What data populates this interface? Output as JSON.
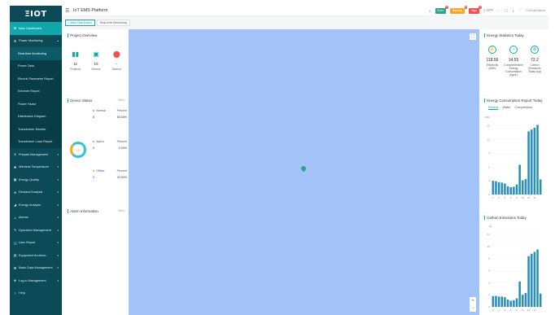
{
  "brand": "ΞIOT",
  "app_title": "IoT EMS Platform",
  "sidebar": {
    "items": [
      {
        "label": "Main Dashboard",
        "icon": "dashboard-icon",
        "glyph": "⊞",
        "state": "active"
      },
      {
        "label": "Power Monitoring",
        "icon": "power-icon",
        "glyph": "⚙",
        "state": "open",
        "arrow": "▴"
      },
      {
        "label": "Real-time Monitoring",
        "sub": true,
        "state": "active"
      },
      {
        "label": "Power Data",
        "sub": true
      },
      {
        "label": "Electric Parameter Report",
        "sub": true
      },
      {
        "label": "Extreme Report",
        "sub": true
      },
      {
        "label": "Power Factor",
        "sub": true
      },
      {
        "label": "Distribution Diagram",
        "sub": true
      },
      {
        "label": "Transformer Monitor",
        "sub": true
      },
      {
        "label": "Transformer Load Report",
        "sub": true
      },
      {
        "label": "Prepaid Management",
        "icon": "wallet-icon",
        "glyph": "$",
        "arrow": "▾"
      },
      {
        "label": "Wireless Temperature",
        "icon": "thermometer-icon",
        "glyph": "✱",
        "arrow": "▾"
      },
      {
        "label": "Energy Quality",
        "icon": "quality-icon",
        "glyph": "▦",
        "arrow": "▾"
      },
      {
        "label": "Demand Analysis",
        "icon": "demand-icon",
        "glyph": "⊕",
        "arrow": "▾"
      },
      {
        "label": "Energy Analysis",
        "icon": "analysis-icon",
        "glyph": "◢",
        "arrow": "▾"
      },
      {
        "label": "Alarms",
        "icon": "bell-icon",
        "glyph": "♫",
        "arrow": "▾"
      },
      {
        "label": "Operation Management",
        "icon": "wrench-icon",
        "glyph": "✎",
        "arrow": "▾"
      },
      {
        "label": "User Report",
        "icon": "report-icon",
        "glyph": "❑",
        "arrow": "▾"
      },
      {
        "label": "Equipment Archives",
        "icon": "archive-icon",
        "glyph": "▤",
        "arrow": "▾"
      },
      {
        "label": "Basic Data Management",
        "icon": "database-icon",
        "glyph": "⌘",
        "arrow": "▾"
      },
      {
        "label": "Log in Management",
        "icon": "login-icon",
        "glyph": "⎈",
        "arrow": "▾"
      },
      {
        "label": "Help",
        "icon": "help-icon",
        "glyph": "?"
      }
    ]
  },
  "topbar": {
    "alarms": [
      {
        "label": "Error",
        "count": "0",
        "color": "#2ca58d"
      },
      {
        "label": "Warning",
        "count": "1",
        "color": "#f5a623"
      },
      {
        "label": "High",
        "count": "0",
        "color": "#f05252"
      }
    ],
    "app_label": "APP",
    "user": "ChChamVieuw"
  },
  "tabs": [
    "Main Dashboard",
    "Real-time Monitoring"
  ],
  "project_overview": {
    "title": "Project Overview",
    "items": [
      {
        "value": "11",
        "label": "Projects",
        "icon": "building-icon",
        "glyph": "▮▮",
        "color": "#11a7ad"
      },
      {
        "value": "10",
        "label": "Meters",
        "icon": "meter-icon",
        "glyph": "▣",
        "color": "#11a7ad"
      },
      {
        "value": "--",
        "label": "Alarms",
        "icon": "alarm-pin-icon",
        "glyph": "⬤",
        "color": "#f05252"
      }
    ]
  },
  "device_status": {
    "title": "Device Status",
    "more": "Other",
    "total": "10",
    "rows": [
      {
        "name": "Normal",
        "count": "8",
        "percent": "80.00%",
        "color": "#2fc4d8"
      },
      {
        "name": "Alarm",
        "count": "0",
        "percent": "0.00%",
        "color": "#f5a623"
      },
      {
        "name": "Offline",
        "count": "2",
        "percent": "20.00%",
        "color": "#f5a623"
      }
    ],
    "percent_header": "Percent"
  },
  "alarm_information": {
    "title": "Alarm Information",
    "more": "Other"
  },
  "energy_statistics": {
    "title": "Energy Statistics Today",
    "items": [
      {
        "value": "118.56",
        "label": "Electricity (kWh)",
        "icon": "electricity-icon",
        "glyph": "⚡"
      },
      {
        "value": "14.55",
        "label": "Comprehensive Energy Consumption (kgce)",
        "icon": "gauge-icon",
        "glyph": "◔"
      },
      {
        "value": "72.2",
        "label": "Carbon Emissions Today (kg)",
        "icon": "carbon-icon",
        "glyph": "♻"
      }
    ]
  },
  "energy_report": {
    "title": "Energy Consumption Report Today",
    "tabs": [
      "Electric",
      "Water",
      "Comprehens"
    ]
  },
  "carbon": {
    "title": "Carbon Emissions Today",
    "unit": "kg"
  },
  "chart_data": [
    {
      "type": "bar",
      "title": "Energy Consumption Report Today",
      "categories": [
        "0",
        "1",
        "2",
        "3",
        "4",
        "5",
        "6",
        "7",
        "8",
        "9",
        "10",
        "11",
        "12",
        "13",
        "14",
        "15",
        "16"
      ],
      "values": [
        3.0,
        2.9,
        2.7,
        2.6,
        2.4,
        1.8,
        1.6,
        1.7,
        2.2,
        6.5,
        3.1,
        3.4,
        13.8,
        14.2,
        14.6,
        15.2,
        3.3
      ],
      "xticks": [
        "0",
        "2",
        "4",
        "6",
        "8",
        "10",
        "12",
        "14"
      ],
      "yticks": [
        "0",
        "3",
        "6",
        "9",
        "12",
        "15"
      ],
      "ylim": [
        0,
        16
      ],
      "series_color": "#2a8fb8",
      "ylabel": "100%"
    },
    {
      "type": "bar",
      "title": "Carbon Emissions Today",
      "categories": [
        "0",
        "1",
        "2",
        "3",
        "4",
        "5",
        "6",
        "7",
        "8",
        "9",
        "10",
        "11",
        "12",
        "13",
        "14",
        "15",
        "16"
      ],
      "values": [
        1.8,
        1.8,
        1.7,
        1.7,
        1.6,
        1.2,
        1.0,
        1.1,
        1.4,
        4.2,
        2.0,
        2.3,
        8.4,
        8.8,
        9.1,
        9.5,
        2.2
      ],
      "xticks": [
        "0",
        "2",
        "4",
        "6",
        "8",
        "10",
        "12",
        "14"
      ],
      "yticks": [
        "0",
        "2",
        "4",
        "6",
        "8",
        "10",
        "12"
      ],
      "ylim": [
        0,
        12
      ],
      "series_color": "#2a8fb8"
    }
  ]
}
